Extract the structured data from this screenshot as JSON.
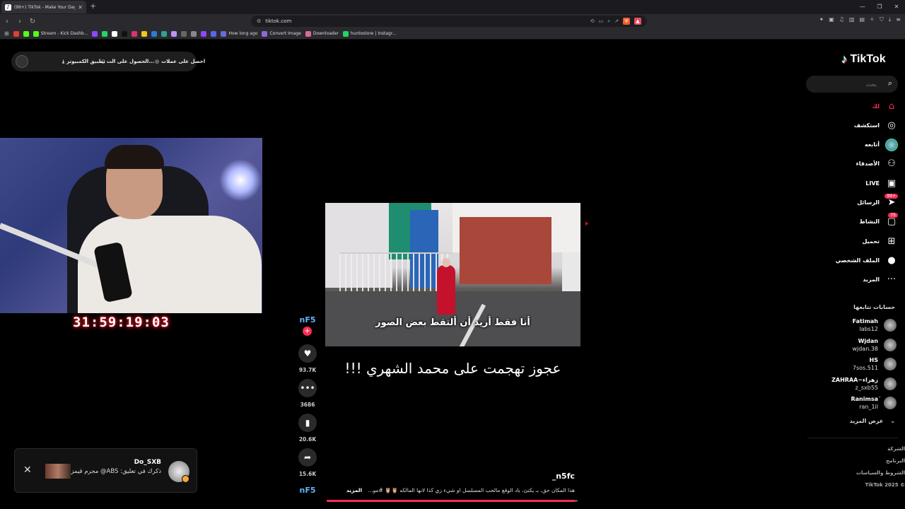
{
  "browser": {
    "tab_title": "(99+) TikTok - Make Your Day",
    "tab_fav": "♪",
    "new_tab": "+",
    "url": "tiktok.com",
    "bookmarks": [
      {
        "label": "",
        "color": "#e23b3b"
      },
      {
        "label": "",
        "color": "#53fc18"
      },
      {
        "label": "Stream - Kick Dashb...",
        "color": "#53fc18"
      },
      {
        "label": "",
        "color": "#9146ff"
      },
      {
        "label": "",
        "color": "#25d366"
      },
      {
        "label": "",
        "color": "#ffffff"
      },
      {
        "label": "",
        "color": "#111111"
      },
      {
        "label": "",
        "color": "#e1306c"
      },
      {
        "label": "",
        "color": "#f3c614"
      },
      {
        "label": "",
        "color": "#2b7bd6"
      },
      {
        "label": "",
        "color": "#2aa198"
      },
      {
        "label": "",
        "color": "#bd93f9"
      },
      {
        "label": "",
        "color": "#666666"
      },
      {
        "label": "",
        "color": "#888888"
      },
      {
        "label": "",
        "color": "#9146ff"
      },
      {
        "label": "",
        "color": "#5865f2"
      },
      {
        "label": "How long ago",
        "color": "#6a6ad6"
      },
      {
        "label": "Convert Image",
        "color": "#8a6ad6"
      },
      {
        "label": "Downloader",
        "color": "#d66a9a"
      },
      {
        "label": "huntostore | Instagr...",
        "color": "#25d366"
      }
    ]
  },
  "topbar": {
    "get_coins": "احصل على عملات",
    "get_app": "الحصول على الت...",
    "desktop_app": "تطبيق الكمبيوتر"
  },
  "webcam": {
    "timer": "31:59:19:03"
  },
  "video": {
    "subtitle": "أنا فقط أريد أن ألتقط بعض الصور",
    "title": "عجوز تهجمت على محمد الشهري !!!",
    "author": "_n5fc",
    "description": "هذا المكان حق، بـ يكتئ، باد الوقع مالحب المسلسل او شيء زي كذا لانها المالكه 🦉🦉 #مو...",
    "more_label": "المزيد",
    "progress": 0.99,
    "side_label": "nF5",
    "follow": "+",
    "likes": "93.7K",
    "comments": "3686",
    "saves": "20.6K",
    "shares": "15.6K"
  },
  "toast": {
    "name": "Do_SXB",
    "message": "ذكرك في تعليق: ABS@ مجرم قيمز",
    "close": "✕"
  },
  "sidebar": {
    "logo": "TikTok",
    "search_placeholder": "بحث",
    "nav": [
      {
        "label": "لك",
        "icon": "home-icon",
        "active": true
      },
      {
        "label": "استكشف",
        "icon": "compass-icon"
      },
      {
        "label": "أتابعه",
        "icon": "avatar-icon"
      },
      {
        "label": "الأصدقاء",
        "icon": "friends-icon"
      },
      {
        "label": "LIVE",
        "icon": "live-icon"
      },
      {
        "label": "الرسائل",
        "icon": "messages-icon",
        "badge": "99+"
      },
      {
        "label": "النشاط",
        "icon": "activity-icon",
        "badge": "75"
      },
      {
        "label": "تحميل",
        "icon": "upload-icon"
      },
      {
        "label": "الملف الشخصي",
        "icon": "profile-icon"
      },
      {
        "label": "المزيد",
        "icon": "more-icon"
      }
    ],
    "following_title": "حسابات تتابعها",
    "following": [
      {
        "name": "Fatimah",
        "handle": "labs12"
      },
      {
        "name": "Wjdan",
        "handle": "wjdan.38"
      },
      {
        "name": "HS",
        "handle": "7sos.511"
      },
      {
        "name": "ZAHRAA~زهراء",
        "handle": "z_sxb55"
      },
      {
        "name": "Ranimsaَ",
        "handle": "ran_1il"
      }
    ],
    "see_more": "عرض المزيد",
    "footer": [
      "الشركة",
      "البرنامج",
      "الشروط والسياسات",
      "TikTok 2025 ©"
    ]
  }
}
